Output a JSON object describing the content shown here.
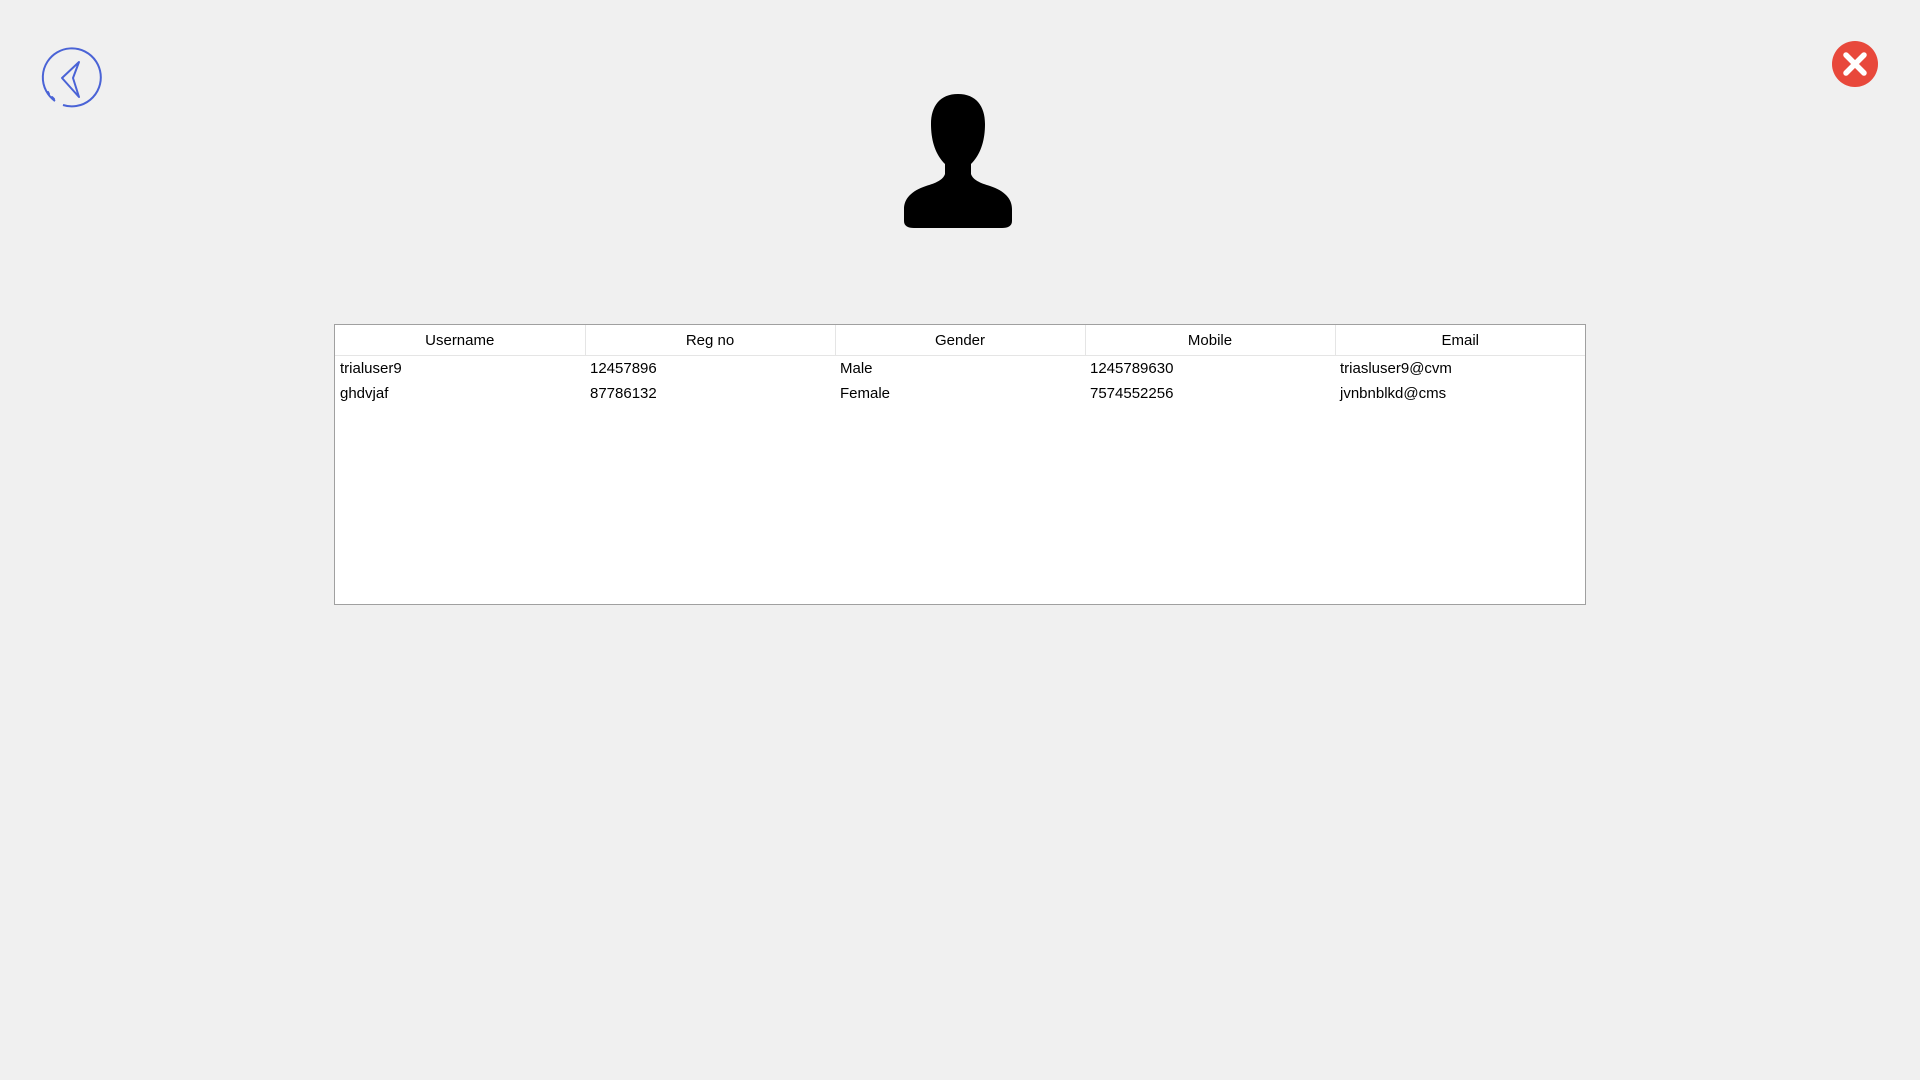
{
  "icons": {
    "back": "back-arrow-icon",
    "close": "close-icon",
    "user": "user-silhouette-icon"
  },
  "colors": {
    "back_icon": "#4a63d6",
    "close_icon": "#e8483b",
    "background": "#f0f0f0"
  },
  "table": {
    "columns": [
      "Username",
      "Reg no",
      "Gender",
      "Mobile",
      "Email"
    ],
    "rows": [
      [
        "trialuser9",
        "12457896",
        "Male",
        "1245789630",
        "triasluser9@cvm"
      ],
      [
        "ghdvjaf",
        "87786132",
        "Female",
        "7574552256",
        "jvnbnblkd@cms"
      ]
    ]
  }
}
